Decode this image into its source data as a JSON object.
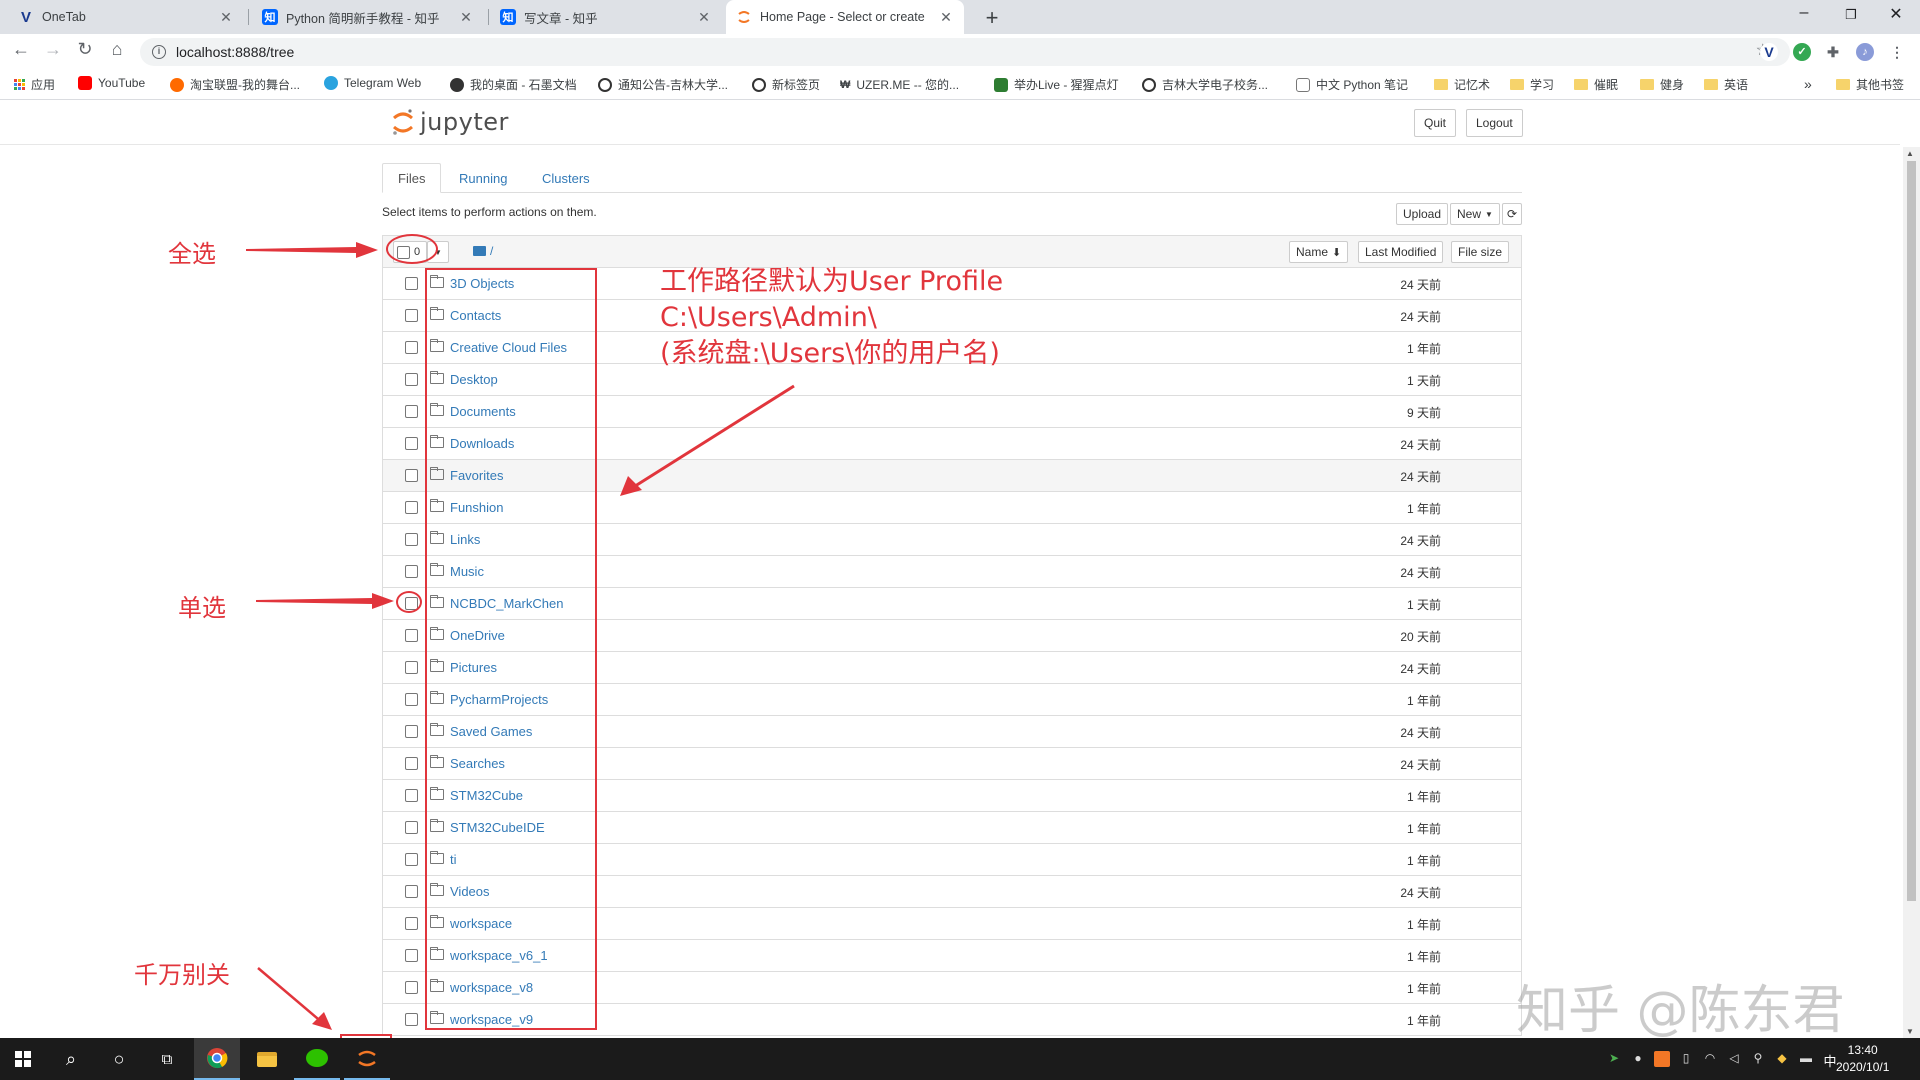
{
  "browser": {
    "tabs": [
      {
        "title": "OneTab",
        "icon": "V",
        "icon_color": "#1a3a8f",
        "icon_text_color": "#ffffff"
      },
      {
        "title": "Python 简明新手教程 - 知乎",
        "icon": "知",
        "icon_color": "#0066ff",
        "icon_text_color": "#ffffff"
      },
      {
        "title": "写文章 - 知乎",
        "icon": "知",
        "icon_color": "#0066ff",
        "icon_text_color": "#ffffff"
      },
      {
        "title": "Home Page - Select or create",
        "icon": "jupyter-icon",
        "icon_color": "#f37726",
        "icon_text_color": "#f37726"
      }
    ],
    "new_tab": "+",
    "window_controls": {
      "minimize": "–",
      "restore": "❐",
      "close": "✕"
    },
    "url": "localhost:8888/tree",
    "bookmarks": [
      {
        "label": "应用",
        "icon_color": "#e94235",
        "type": "apps"
      },
      {
        "label": "YouTube",
        "icon_color": "#ff0000",
        "type": "site"
      },
      {
        "label": "淘宝联盟-我的舞台...",
        "icon_color": "#ff6a00",
        "type": "site"
      },
      {
        "label": "Telegram Web",
        "icon_color": "#2aa3df",
        "type": "site"
      },
      {
        "label": "我的桌面 - 石墨文档",
        "icon_color": "#333333",
        "type": "site"
      },
      {
        "label": "通知公告-吉林大学...",
        "icon_color": "#333333",
        "type": "site"
      },
      {
        "label": "新标签页",
        "icon_color": "#333333",
        "type": "site"
      },
      {
        "label": "UZER.ME -- 您的...",
        "icon_color": "#333333",
        "type": "site"
      },
      {
        "label": "举办Live - 猩猩点灯",
        "icon_color": "#2e7d32",
        "type": "site"
      },
      {
        "label": "吉林大学电子校务...",
        "icon_color": "#333333",
        "type": "site"
      },
      {
        "label": "中文 Python 笔记",
        "icon_color": "#777777",
        "type": "site"
      },
      {
        "label": "记忆术",
        "type": "folder"
      },
      {
        "label": "学习",
        "type": "folder"
      },
      {
        "label": "催眠",
        "type": "folder"
      },
      {
        "label": "健身",
        "type": "folder"
      },
      {
        "label": "英语",
        "type": "folder"
      }
    ],
    "bookmarks_more": "»",
    "other_bookmarks": "其他书签"
  },
  "jupyter": {
    "logo_text": "jupyter",
    "quit_label": "Quit",
    "logout_label": "Logout",
    "tabs": [
      "Files",
      "Running",
      "Clusters"
    ],
    "instructions": "Select items to perform actions on them.",
    "upload_label": "Upload",
    "new_label": "New",
    "refresh_icon": "refresh-icon",
    "selected_count": "0",
    "breadcrumb": "/",
    "sort_name": "Name",
    "sort_modified": "Last Modified",
    "sort_size": "File size",
    "files": [
      {
        "name": "3D Objects",
        "modified": "24 天前"
      },
      {
        "name": "Contacts",
        "modified": "24 天前"
      },
      {
        "name": "Creative Cloud Files",
        "modified": "1 年前"
      },
      {
        "name": "Desktop",
        "modified": "1 天前"
      },
      {
        "name": "Documents",
        "modified": "9 天前"
      },
      {
        "name": "Downloads",
        "modified": "24 天前"
      },
      {
        "name": "Favorites",
        "modified": "24 天前"
      },
      {
        "name": "Funshion",
        "modified": "1 年前"
      },
      {
        "name": "Links",
        "modified": "24 天前"
      },
      {
        "name": "Music",
        "modified": "24 天前"
      },
      {
        "name": "NCBDC_MarkChen",
        "modified": "1 天前"
      },
      {
        "name": "OneDrive",
        "modified": "20 天前"
      },
      {
        "name": "Pictures",
        "modified": "24 天前"
      },
      {
        "name": "PycharmProjects",
        "modified": "1 年前"
      },
      {
        "name": "Saved Games",
        "modified": "24 天前"
      },
      {
        "name": "Searches",
        "modified": "24 天前"
      },
      {
        "name": "STM32Cube",
        "modified": "1 年前"
      },
      {
        "name": "STM32CubeIDE",
        "modified": "1 年前"
      },
      {
        "name": "ti",
        "modified": "1 年前"
      },
      {
        "name": "Videos",
        "modified": "24 天前"
      },
      {
        "name": "workspace",
        "modified": "1 年前"
      },
      {
        "name": "workspace_v6_1",
        "modified": "1 年前"
      },
      {
        "name": "workspace_v8",
        "modified": "1 年前"
      },
      {
        "name": "workspace_v9",
        "modified": "1 年前"
      }
    ]
  },
  "annotations": {
    "select_all": "全选",
    "single_select": "单选",
    "do_not_close": "千万别关",
    "path_line1": "工作路径默认为User Profile",
    "path_line2": "C:\\Users\\Admin\\",
    "path_line3": "(系统盘:\\Users\\你的用户名)",
    "color": "#e1353c"
  },
  "watermark": "知乎 @陈东君",
  "taskbar": {
    "clock_time": "13:40",
    "clock_date": "2020/10/1",
    "ime": "中"
  }
}
